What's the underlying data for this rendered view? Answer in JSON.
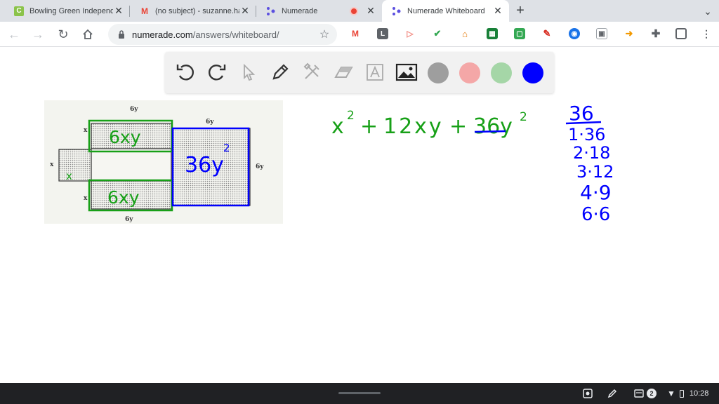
{
  "tabs": [
    {
      "title": "Bowling Green Independent Sc",
      "favicon": "C",
      "favicon_color": "#8bc34a",
      "active": false
    },
    {
      "title": "(no subject) - suzanne.harwo",
      "favicon": "M",
      "favicon_color": "#ea4335",
      "active": false
    },
    {
      "title": "Numerade",
      "favicon": "numerade-logo",
      "favicon_color": "#5b4fe0",
      "active": false,
      "recording": true
    },
    {
      "title": "Numerade Whiteboard",
      "favicon": "numerade-logo",
      "favicon_color": "#5b4fe0",
      "active": true
    }
  ],
  "address_bar": {
    "domain": "numerade.com",
    "path": "/answers/whiteboard/"
  },
  "extensions": [
    "gmail-ext",
    "L",
    "cast-ext",
    "check-ext",
    "home-ext",
    "grid-ext",
    "screen-ext",
    "pen-ext",
    "globe-ext",
    "image-ext",
    "arrow-ext",
    "puzzle-icon",
    "sidebar-icon",
    "more-icon"
  ],
  "whiteboard": {
    "tools": [
      "undo",
      "redo",
      "select",
      "pen",
      "tools",
      "eraser",
      "text",
      "image"
    ],
    "colors": [
      "#9e9e9e",
      "#f4a7a7",
      "#a5d6a7",
      "#0000ff"
    ],
    "selected_color": "#0000ff"
  },
  "diagram_labels": {
    "top_label": "6y",
    "bottom_label": "6y",
    "square_top": "6y",
    "square_right": "6y",
    "left_x": "x",
    "row_top_x": "x",
    "row_bottom_x": "x",
    "small_square": "x",
    "rect_top": "6xy",
    "rect_bottom": "6xy",
    "big_square": "36y"
  },
  "expression": {
    "t1": "x",
    "t1exp": "2",
    "op1": "+",
    "t2": "12xy",
    "op2": "+",
    "t3": "36y",
    "t3exp": "2"
  },
  "factors": {
    "header": "36",
    "pairs": [
      "1·36",
      "2·18",
      "3·12",
      "4·9",
      "6·6"
    ]
  },
  "shelf": {
    "notification_count": "2",
    "time": "10:28"
  }
}
